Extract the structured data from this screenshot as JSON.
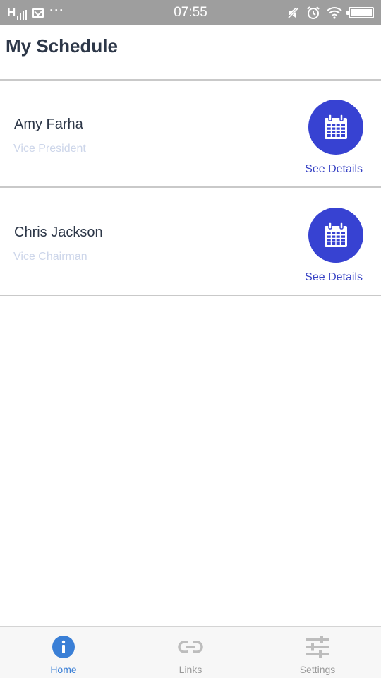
{
  "status_bar": {
    "signal_text": "H",
    "more_glyph": "···",
    "time": "07:55",
    "icons": [
      "signal-icon",
      "mail-icon",
      "more-icon",
      "mute-icon",
      "alarm-icon",
      "wifi-icon",
      "battery-icon"
    ]
  },
  "header": {
    "title": "My Schedule"
  },
  "schedule": [
    {
      "name": "Amy Farha",
      "role": "Vice President",
      "link_label": "See Details",
      "icon": "calendar-icon"
    },
    {
      "name": "Chris Jackson",
      "role": "Vice Chairman",
      "link_label": "See Details",
      "icon": "calendar-icon"
    }
  ],
  "bottom_nav": {
    "items": [
      {
        "label": "Home",
        "icon": "info-icon",
        "active": true
      },
      {
        "label": "Links",
        "icon": "link-icon",
        "active": false
      },
      {
        "label": "Settings",
        "icon": "sliders-icon",
        "active": false
      }
    ]
  },
  "colors": {
    "status_bar": "#9e9e9e",
    "accent": "#3742d2",
    "link": "#3742c4",
    "nav_active": "#3a7fd6",
    "nav_inactive": "#999999",
    "subtitle": "#cdd6ea"
  }
}
